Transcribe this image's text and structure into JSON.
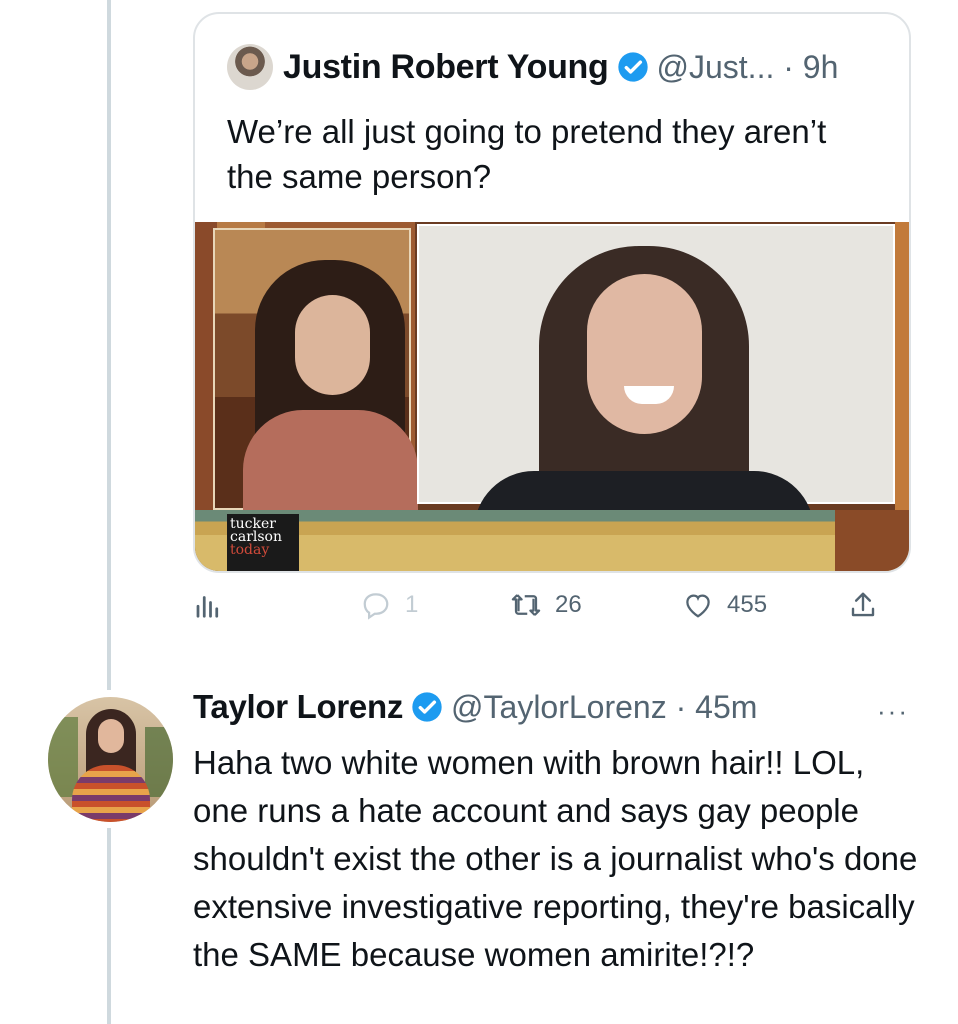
{
  "quoted_tweet": {
    "author_name": "Justin Robert Young",
    "handle_time": "@Just... · 9h",
    "text": "We’re all just going to pretend they aren’t the same person?",
    "media": {
      "logo_line1": "tucker",
      "logo_line2": "carlson",
      "logo_line3": "today"
    }
  },
  "quoted_actions": {
    "replies": "1",
    "retweets": "26",
    "likes": "455"
  },
  "reply_tweet": {
    "author_name": "Taylor Lorenz",
    "handle_time": "@TaylorLorenz · 45m",
    "more": "···",
    "text": "Haha two white women with brown hair!! LOL, one runs a hate account and says gay people shouldn't exist the other is a journalist who's done extensive investigative reporting, they're basically the SAME because women amirite!?!?"
  },
  "colors": {
    "verified": "#1d9bf0",
    "secondary_text": "#536471",
    "thread_line": "#cfd9de",
    "card_border": "#dfe3e6"
  },
  "icons": [
    "avatar-image",
    "verified-badge-icon",
    "analytics-icon",
    "reply-icon",
    "retweet-icon",
    "like-icon",
    "share-icon",
    "more-icon"
  ]
}
